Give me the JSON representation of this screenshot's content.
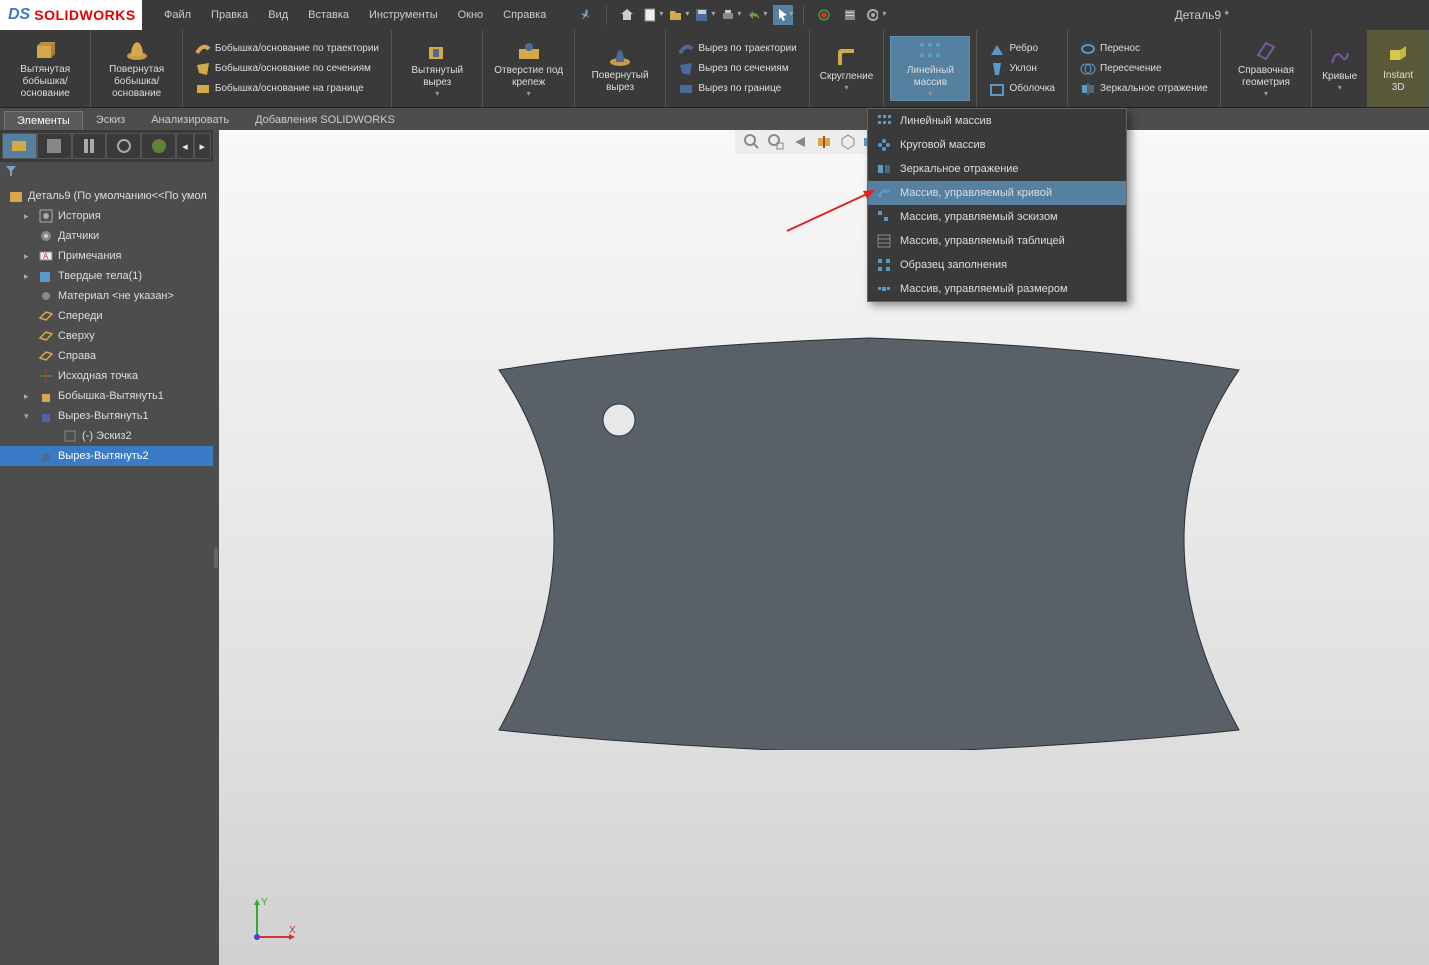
{
  "app": {
    "name": "SOLIDWORKS",
    "doc_title": "Деталь9 *"
  },
  "menu": {
    "items": [
      "Файл",
      "Правка",
      "Вид",
      "Вставка",
      "Инструменты",
      "Окно",
      "Справка"
    ]
  },
  "ribbon_tabs": {
    "items": [
      "Элементы",
      "Эскиз",
      "Анализировать",
      "Добавления SOLIDWORKS"
    ],
    "active_index": 0
  },
  "ribbon": {
    "extruded_boss": "Вытянутая бобышка/основание",
    "revolved_boss": "Повернутая бобышка/основание",
    "swept_boss": "Бобышка/основание по траектории",
    "lofted_boss": "Бобышка/основание по сечениям",
    "boundary_boss": "Бобышка/основание на границе",
    "extruded_cut": "Вытянутый вырез",
    "hole_wizard": "Отверстие под крепеж",
    "revolved_cut": "Повернутый вырез",
    "swept_cut": "Вырез по траектории",
    "lofted_cut": "Вырез по сечениям",
    "boundary_cut": "Вырез по границе",
    "fillet": "Скругление",
    "linear_pattern": "Линейный массив",
    "rib": "Ребро",
    "draft": "Уклон",
    "shell": "Оболочка",
    "wrap": "Перенос",
    "intersect": "Пересечение",
    "mirror": "Зеркальное отражение",
    "ref_geom": "Справочная геометрия",
    "curves": "Кривые",
    "instant3d": "Instant 3D"
  },
  "pattern_dropdown": {
    "items": [
      "Линейный массив",
      "Круговой массив",
      "Зеркальное отражение",
      "Массив, управляемый кривой",
      "Массив, управляемый эскизом",
      "Массив, управляемый таблицей",
      "Образец заполнения",
      "Массив, управляемый размером"
    ],
    "hover_index": 3
  },
  "tree": {
    "root": "Деталь9  (По умолчанию<<По умол",
    "items": [
      {
        "label": "История",
        "indent": 1,
        "expand": "▸",
        "icon": "history"
      },
      {
        "label": "Датчики",
        "indent": 1,
        "expand": "",
        "icon": "sensor"
      },
      {
        "label": "Примечания",
        "indent": 1,
        "expand": "▸",
        "icon": "annotation"
      },
      {
        "label": "Твердые тела(1)",
        "indent": 1,
        "expand": "▸",
        "icon": "solid"
      },
      {
        "label": "Материал <не указан>",
        "indent": 1,
        "expand": "",
        "icon": "material"
      },
      {
        "label": "Спереди",
        "indent": 1,
        "expand": "",
        "icon": "plane"
      },
      {
        "label": "Сверху",
        "indent": 1,
        "expand": "",
        "icon": "plane"
      },
      {
        "label": "Справа",
        "indent": 1,
        "expand": "",
        "icon": "plane"
      },
      {
        "label": "Исходная точка",
        "indent": 1,
        "expand": "",
        "icon": "origin"
      },
      {
        "label": "Бобышка-Вытянуть1",
        "indent": 1,
        "expand": "▸",
        "icon": "extrude"
      },
      {
        "label": "Вырез-Вытянуть1",
        "indent": 1,
        "expand": "▾",
        "icon": "cut"
      },
      {
        "label": "(-) Эскиз2",
        "indent": 2,
        "expand": "",
        "icon": "sketch"
      },
      {
        "label": "Вырез-Вытянуть2",
        "indent": 1,
        "expand": "",
        "icon": "cut",
        "selected": true
      }
    ]
  },
  "coord": {
    "x": "X",
    "y": "Y"
  }
}
